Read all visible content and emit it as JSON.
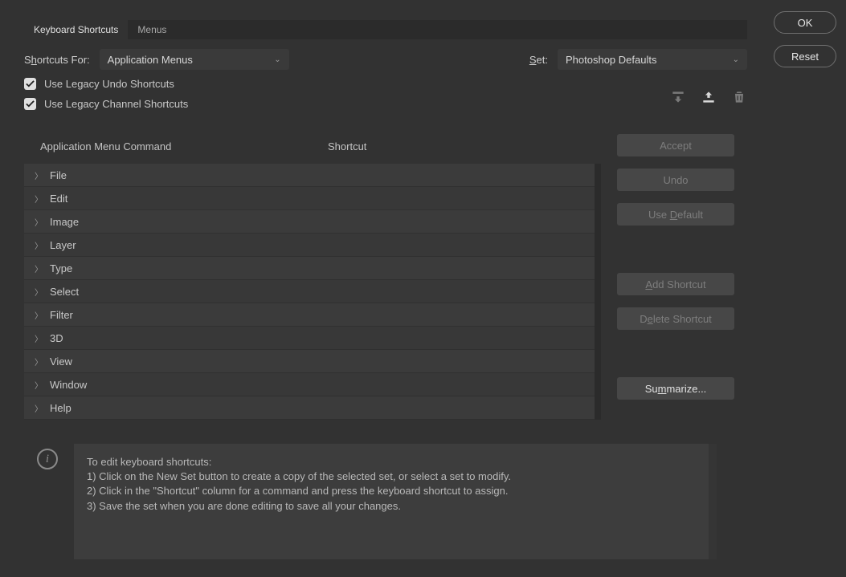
{
  "tabs": {
    "shortcuts": "Keyboard Shortcuts",
    "menus": "Menus"
  },
  "shortcutsForLabelPre": "S",
  "shortcutsForLabelMid": "h",
  "shortcutsForLabelPost": "ortcuts For:",
  "shortcutsForValue": "Application Menus",
  "setLabelPre": "S",
  "setLabelPost": "et:",
  "setValue": "Photoshop Defaults",
  "legacyUndo": "Use Legacy Undo Shortcuts",
  "legacyChannel": "Use Legacy Channel Shortcuts",
  "columns": {
    "command": "Application Menu Command",
    "shortcut": "Shortcut"
  },
  "menuItems": [
    "File",
    "Edit",
    "Image",
    "Layer",
    "Type",
    "Select",
    "Filter",
    "3D",
    "View",
    "Window",
    "Help"
  ],
  "buttons": {
    "ok": "OK",
    "reset": "Reset",
    "accept": "Accept",
    "undo": "Undo",
    "useDefault_pre": "Use ",
    "useDefault_u": "D",
    "useDefault_post": "efault",
    "addShortcut_u": "A",
    "addShortcut_post": "dd Shortcut",
    "deleteShortcut_pre": "D",
    "deleteShortcut_u": "e",
    "deleteShortcut_post": "lete Shortcut",
    "summarize_pre": "Su",
    "summarize_u": "m",
    "summarize_post": "marize..."
  },
  "info": {
    "l1": "To edit keyboard shortcuts:",
    "l2": "1) Click on the New Set button to create a copy of the selected set, or select a set to modify.",
    "l3": "2) Click in the \"Shortcut\" column for a command and press the keyboard shortcut to assign.",
    "l4": "3) Save the set when you are done editing to save all your changes."
  }
}
